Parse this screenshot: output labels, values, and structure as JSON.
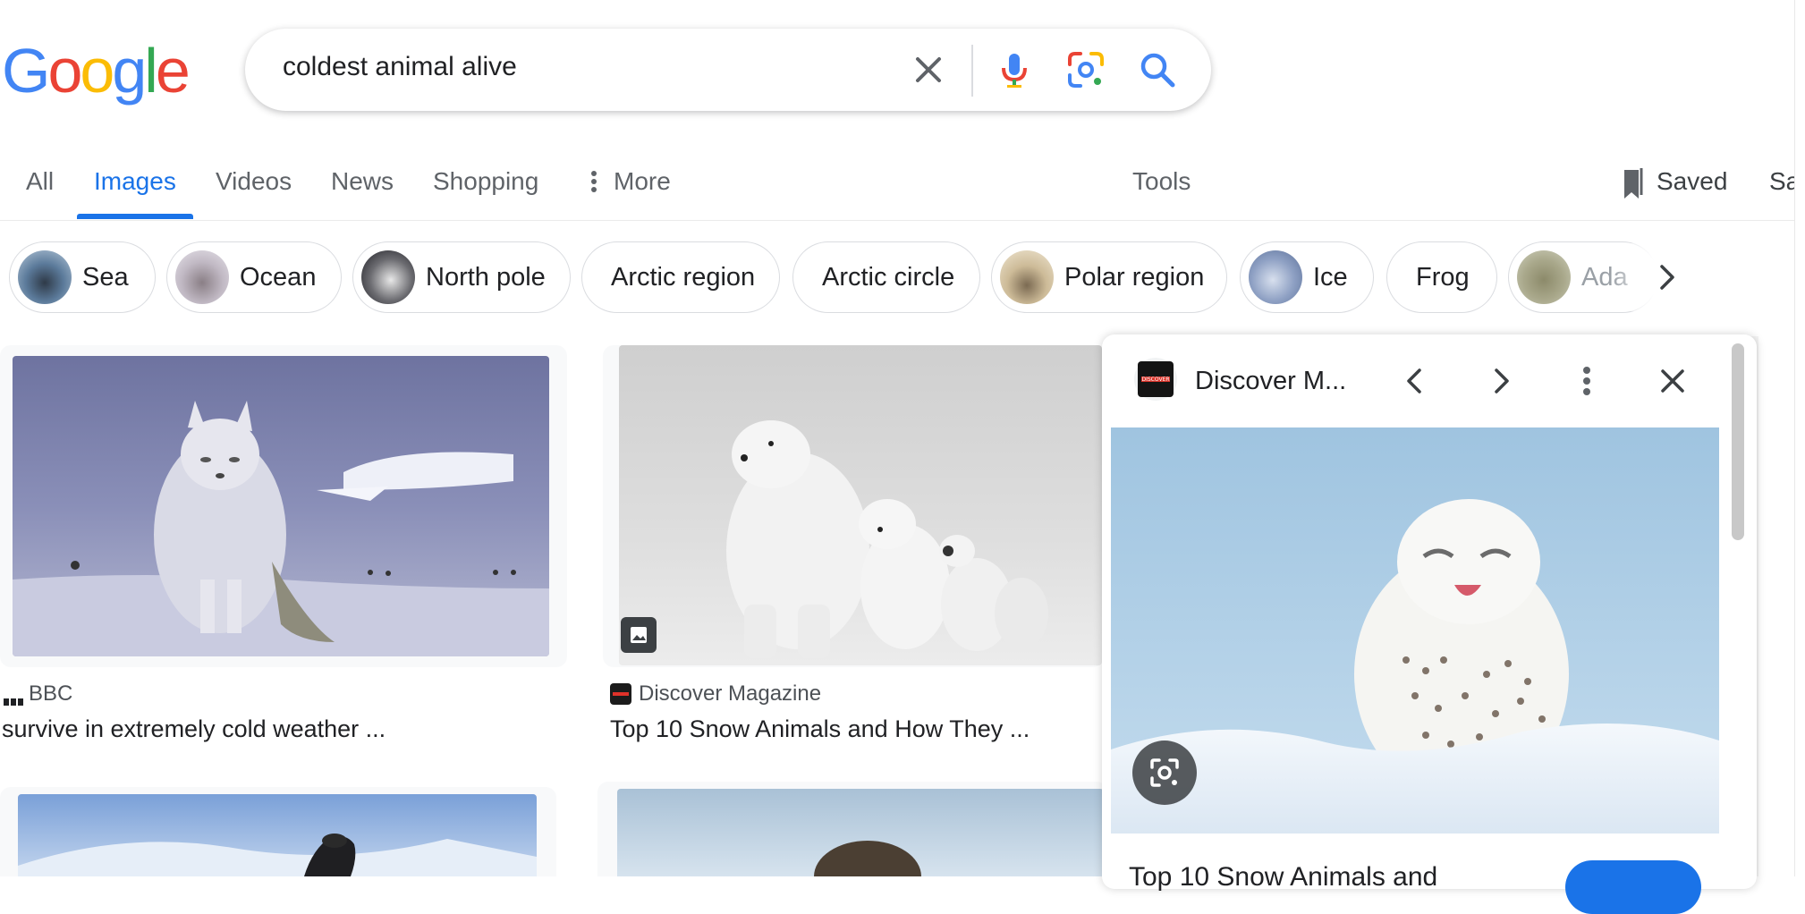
{
  "search": {
    "query": "coldest animal alive"
  },
  "tabs": [
    {
      "label": "All"
    },
    {
      "label": "Images",
      "active": true
    },
    {
      "label": "Videos"
    },
    {
      "label": "News"
    },
    {
      "label": "Shopping"
    },
    {
      "label": "More"
    }
  ],
  "tools_label": "Tools",
  "saved_label": "Saved",
  "cut_label": "Sa",
  "chips": [
    {
      "label": "Sea"
    },
    {
      "label": "Ocean"
    },
    {
      "label": "North pole"
    },
    {
      "label": "Arctic region"
    },
    {
      "label": "Arctic circle"
    },
    {
      "label": "Polar region"
    },
    {
      "label": "Ice"
    },
    {
      "label": "Frog"
    },
    {
      "label": "Ada"
    }
  ],
  "results": [
    {
      "source": "BBC",
      "title": "survive in extremely cold weather ..."
    },
    {
      "source": "Discover Magazine",
      "title": "Top 10 Snow Animals and How They ..."
    }
  ],
  "panel": {
    "source": "Discover M...",
    "logo_text": "DISCOVER",
    "next_title": "Top 10 Snow Animals and"
  },
  "icons": {
    "clear": "close-icon",
    "mic": "microphone-icon",
    "lens": "google-lens-icon",
    "search": "search-icon",
    "more": "vertical-dots-icon",
    "saved": "bookmark-icon",
    "chips_next": "chevron-right-icon",
    "prev": "chevron-left-icon",
    "next": "chevron-right-icon",
    "close": "close-icon",
    "visual_search": "lens-search-icon",
    "image_badge": "image-icon"
  },
  "colors": {
    "accent": "#1a73e8",
    "google_blue": "#4285f4",
    "google_red": "#ea4335",
    "google_yellow": "#fbbc05",
    "google_green": "#34a853"
  }
}
